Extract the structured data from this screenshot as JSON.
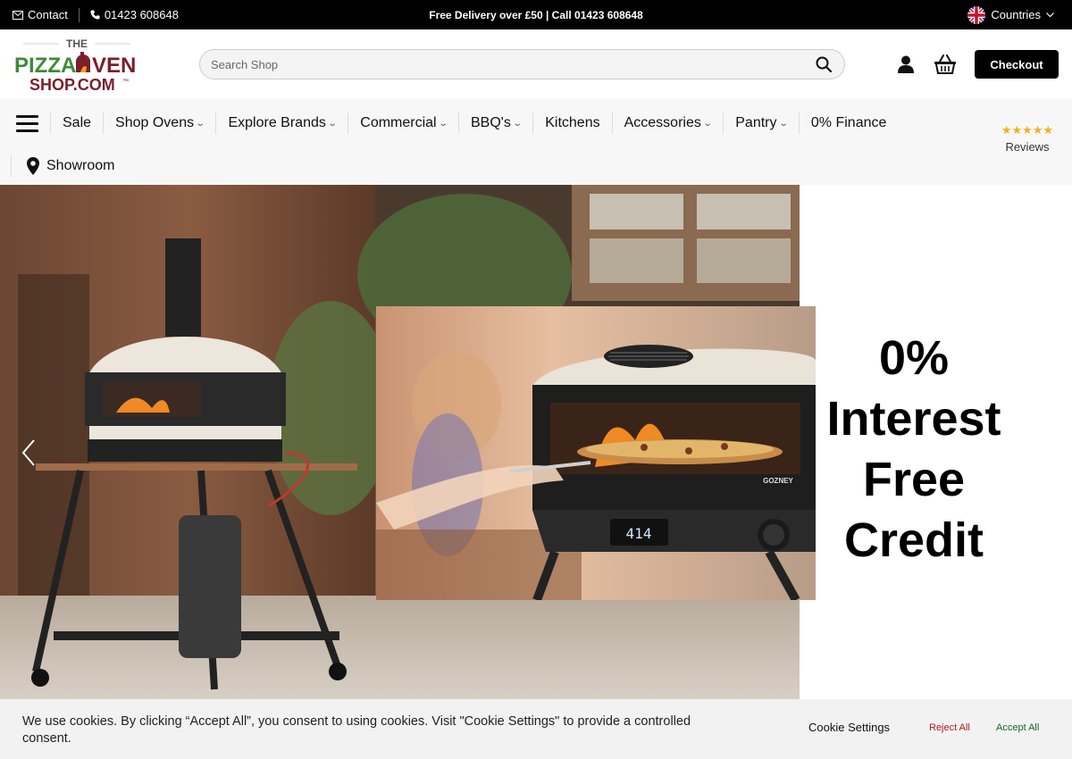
{
  "topbar": {
    "contact_label": "Contact",
    "phone_label": "01423 608648",
    "promo": "Free Delivery over £50 | Call 01423 608648",
    "countries_label": "Countries"
  },
  "header": {
    "logo": {
      "line1": "THE",
      "line2a": "PIZZA",
      "line2b": "VEN",
      "line3": "SHOP.COM",
      "tm": "™"
    },
    "search_placeholder": "Search Shop",
    "checkout_label": "Checkout"
  },
  "nav": {
    "items": [
      {
        "label": "Sale",
        "dropdown": false
      },
      {
        "label": "Shop Ovens",
        "dropdown": true
      },
      {
        "label": "Explore Brands",
        "dropdown": true
      },
      {
        "label": "Commercial",
        "dropdown": true
      },
      {
        "label": "BBQ's",
        "dropdown": true
      },
      {
        "label": "Kitchens",
        "dropdown": false
      },
      {
        "label": "Accessories",
        "dropdown": true
      },
      {
        "label": "Pantry",
        "dropdown": true
      },
      {
        "label": "0% Finance",
        "dropdown": false
      }
    ],
    "showroom_label": "Showroom",
    "reviews": {
      "stars": "★★★★★",
      "label": "Reviews"
    }
  },
  "hero": {
    "headline": [
      "0%",
      "Interest",
      "Free",
      "Credit"
    ],
    "oven_brand": "GOZNEY",
    "display_temp": "414"
  },
  "cookie": {
    "message": "We use cookies. By clicking “Accept All”, you consent to using cookies. Visit \"Cookie Settings\" to provide a controlled consent.",
    "settings_label": "Cookie Settings",
    "reject_label": "Reject All",
    "accept_label": "Accept All"
  },
  "colors": {
    "brand_green": "#3f8a3a",
    "brand_maroon": "#7a1f2b",
    "brand_red": "#c0392b",
    "star_gold": "#f2b01e"
  }
}
